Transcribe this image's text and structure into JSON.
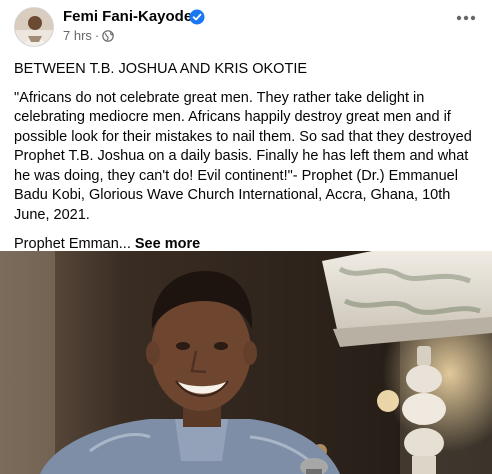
{
  "post": {
    "author": "Femi Fani-Kayode",
    "time": "7 hrs",
    "heading": "BETWEEN T.B. JOSHUA AND KRIS OKOTIE",
    "quote": "\"Africans do not celebrate great men. They rather take delight in celebrating mediocre men. Africans happily destroy great men and if possible look for their mistakes to nail them. So sad that they destroyed Prophet T.B. Joshua on a daily basis. Finally he has left them and what he was doing, they can't do! Evil continent!\"- Prophet (Dr.) Emmanuel Badu Kobi, Glorious Wave Church International, Accra, Ghana, 10th June, 2021.",
    "truncated_text": "Prophet Emman...",
    "see_more_label": "See more"
  },
  "icons": {
    "verified": "verified-badge-icon",
    "privacy": "globe-icon",
    "menu": "more-options-icon"
  },
  "colors": {
    "verified_badge": "#1877f2",
    "meta_text": "#65676b",
    "text": "#050505"
  }
}
